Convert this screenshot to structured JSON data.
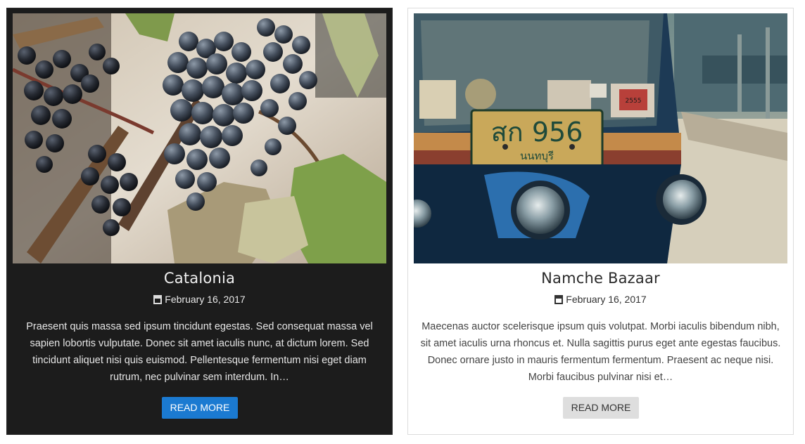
{
  "posts": [
    {
      "title": "Catalonia",
      "date": "February 16, 2017",
      "date_icon": "calendar-icon",
      "image": "grapes-photo",
      "excerpt": "Praesent quis massa sed ipsum tincidunt egestas. Sed consequat massa vel sapien lobortis vulputate. Donec sit amet iaculis nunc, at dictum lorem. Sed tincidunt aliquet nisi quis euismod. Pellentesque fermentum nisi eget diam rutrum, nec pulvinar sem interdum. In…",
      "button_label": "READ MORE",
      "theme": "dark",
      "button_color": "#1b7ad1"
    },
    {
      "title": "Namche Bazaar",
      "date": "February 16, 2017",
      "date_icon": "calendar-icon",
      "image": "tuk-tuk-photo",
      "plate_text": "สก 956",
      "plate_subtext": "นนทบุรี",
      "sticker_text": "2555",
      "excerpt": "Maecenas auctor scelerisque ipsum quis volutpat. Morbi iaculis bibendum nibh, sit amet iaculis urna rhoncus et. Nulla sagittis purus eget ante egestas faucibus. Donec ornare justo in mauris fermentum fermentum. Praesent ac neque nisi. Morbi faucibus pulvinar nisi et…",
      "button_label": "READ MORE",
      "theme": "light",
      "button_color": "#dedede"
    }
  ]
}
